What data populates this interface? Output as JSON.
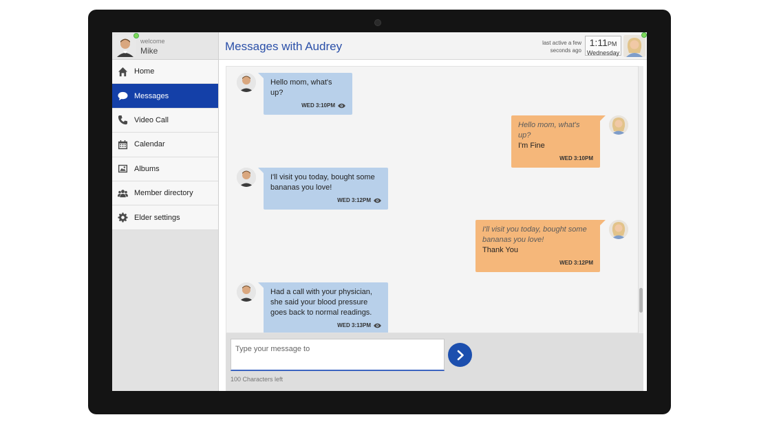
{
  "user": {
    "welcome_label": "welcome",
    "name": "Mike"
  },
  "nav": {
    "items": [
      {
        "label": "Home",
        "icon": "home-icon"
      },
      {
        "label": "Messages",
        "icon": "chat-bubble-icon",
        "active": true
      },
      {
        "label": "Video Call",
        "icon": "phone-icon"
      },
      {
        "label": "Calendar",
        "icon": "calendar-icon"
      },
      {
        "label": "Albums",
        "icon": "image-icon"
      },
      {
        "label": "Member directory",
        "icon": "people-icon"
      },
      {
        "label": "Elder settings",
        "icon": "gear-icon"
      }
    ]
  },
  "header": {
    "title": "Messages with Audrey",
    "last_active_line1": "last active a few",
    "last_active_line2": "seconds ago",
    "clock_time": "1:11",
    "clock_ampm": "PM",
    "clock_day": "Wednesday"
  },
  "messages": [
    {
      "from": "Mike",
      "text_lines": [
        "Hello mom, what's up?"
      ],
      "time": "WED 3:10PM",
      "seen": true
    },
    {
      "from": "Audrey",
      "quote_lines": [
        "Hello mom, what's up?"
      ],
      "text_lines": [
        "I'm Fine"
      ],
      "time": "WED 3:10PM"
    },
    {
      "from": "Mike",
      "text_lines": [
        "I'll visit you today, bought some",
        "bananas you love!"
      ],
      "time": "WED 3:12PM",
      "seen": true
    },
    {
      "from": "Audrey",
      "quote_lines": [
        "I'll visit you today, bought some",
        "bananas you love!"
      ],
      "text_lines": [
        "Thank You"
      ],
      "time": "WED 3:12PM"
    },
    {
      "from": "Mike",
      "text_lines": [
        "Had a call with your physician,",
        "she said your blood pressure",
        "goes back to normal readings."
      ],
      "time": "WED 3:13PM",
      "seen": true
    }
  ],
  "composer": {
    "placeholder": "Type your message to",
    "chars_left": "100 Characters left"
  },
  "colors": {
    "accent": "#1440a8",
    "incoming_bubble": "#b8d0ea",
    "outgoing_bubble": "#f5b77a",
    "online": "#7ed957"
  }
}
